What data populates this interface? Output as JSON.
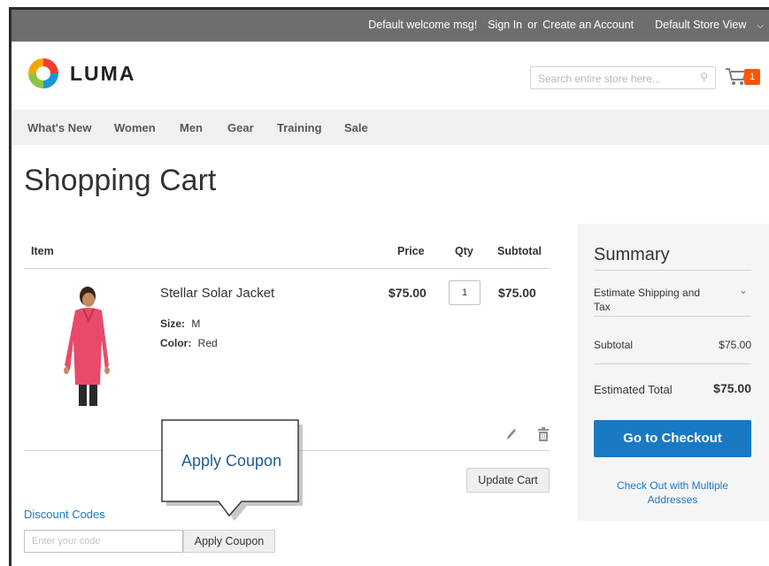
{
  "topbar": {
    "welcome": "Default welcome msg!",
    "sign_in": "Sign In",
    "or": "or",
    "create_account": "Create an Account",
    "store_view": "Default Store View"
  },
  "header": {
    "logo_text": "LUMA",
    "search_placeholder": "Search entire store here...",
    "cart_count": "1"
  },
  "nav": {
    "items": [
      "What's New",
      "Women",
      "Men",
      "Gear",
      "Training",
      "Sale"
    ]
  },
  "page": {
    "title": "Shopping Cart"
  },
  "cart": {
    "columns": {
      "item": "Item",
      "price": "Price",
      "qty": "Qty",
      "subtotal": "Subtotal"
    },
    "items": [
      {
        "name": "Stellar Solar Jacket",
        "size_label": "Size:",
        "size": "M",
        "color_label": "Color:",
        "color": "Red",
        "price": "$75.00",
        "qty": "1",
        "subtotal": "$75.00"
      }
    ],
    "update_label": "Update Cart"
  },
  "callout": {
    "text": "Apply Coupon"
  },
  "discount": {
    "title": "Discount Codes",
    "placeholder": "Enter your code",
    "button_label": "Apply Coupon"
  },
  "summary": {
    "title": "Summary",
    "estimate_shipping": "Estimate Shipping and Tax",
    "subtotal_label": "Subtotal",
    "subtotal_value": "$75.00",
    "total_label": "Estimated Total",
    "total_value": "$75.00",
    "checkout_label": "Go to Checkout",
    "multi_label": "Check Out with Multiple Addresses"
  },
  "colors": {
    "accent": "#1979c3",
    "badge": "#ff5501",
    "topbar": "#6e6e6e"
  }
}
